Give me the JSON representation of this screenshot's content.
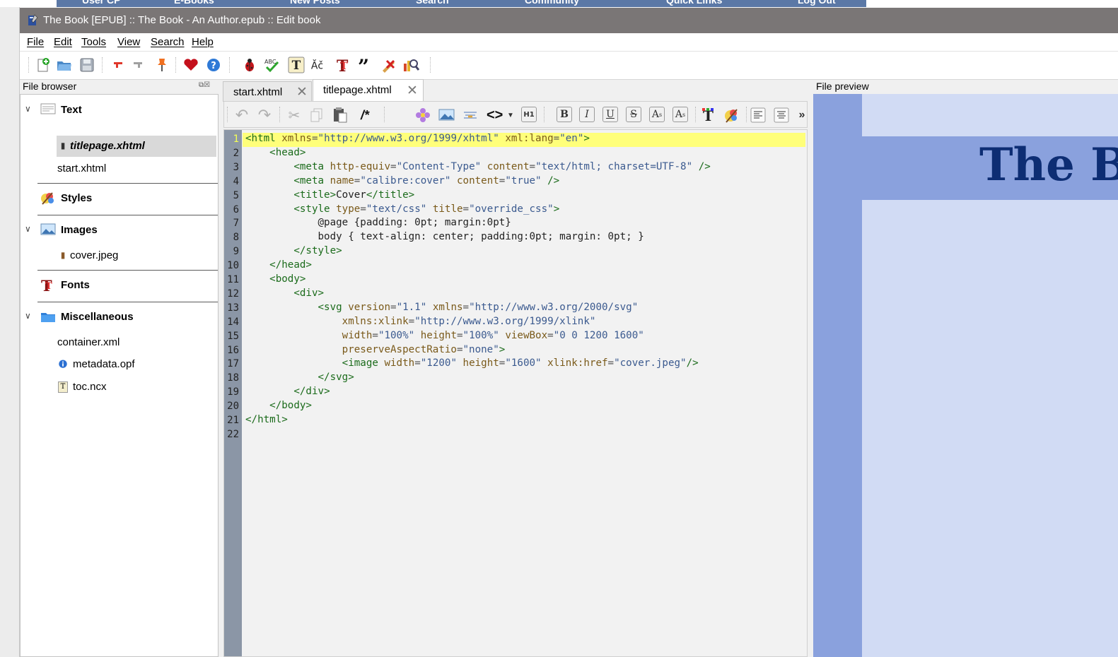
{
  "background_site": {
    "nav_items": [
      "User CP",
      "E-Books",
      "New Posts",
      "Search",
      "Community",
      "Quick Links",
      "Log Out"
    ]
  },
  "window": {
    "title": "The Book [EPUB] :: The Book - An Author.epub :: Edit book"
  },
  "menu": [
    "File",
    "Edit",
    "Tools",
    "View",
    "Search",
    "Help"
  ],
  "toolbar_icons": [
    "new-file-icon",
    "open-folder-icon",
    "save-icon",
    "previous-checkpoint-icon",
    "next-checkpoint-icon",
    "pin-icon",
    "heart-icon",
    "help-icon",
    "bug-check-icon",
    "spell-check-icon",
    "text-tool-icon",
    "accents-icon",
    "fonts-tool-icon",
    "smart-quotes-icon",
    "remove-unused-icon",
    "reports-icon"
  ],
  "file_browser": {
    "label": "File browser",
    "categories": [
      {
        "label": "Text",
        "files": [
          "titlepage.xhtml",
          "start.xhtml"
        ]
      },
      {
        "label": "Styles",
        "files": []
      },
      {
        "label": "Images",
        "files": [
          "cover.jpeg"
        ]
      },
      {
        "label": "Fonts",
        "files": []
      },
      {
        "label": "Miscellaneous",
        "files": [
          "container.xml",
          "metadata.opf",
          "toc.ncx"
        ]
      }
    ],
    "selected_file": "titlepage.xhtml"
  },
  "tabs": [
    {
      "label": "start.xhtml",
      "active": false
    },
    {
      "label": "titlepage.xhtml",
      "active": true
    }
  ],
  "editor_toolbar": {
    "comment_label": "/*",
    "heading_label": "H1",
    "bold": "B",
    "italic": "I",
    "underline": "U",
    "strike": "S",
    "superscript": "A",
    "subscript": "A",
    "more": "»"
  },
  "editor": {
    "current_line": 1,
    "line_numbers": [
      "1",
      "2",
      "3",
      "4",
      "5",
      "6",
      "7",
      "8",
      "9",
      "10",
      "11",
      "12",
      "13",
      "14",
      "15",
      "16",
      "17",
      "18",
      "19",
      "20",
      "21",
      "22"
    ],
    "lines": [
      "<html xmlns=\"http://www.w3.org/1999/xhtml\" xml:lang=\"en\">",
      "    <head>",
      "        <meta http-equiv=\"Content-Type\" content=\"text/html; charset=UTF-8\" />",
      "        <meta name=\"calibre:cover\" content=\"true\" />",
      "        <title>Cover</title>",
      "        <style type=\"text/css\" title=\"override_css\">",
      "            @page {padding: 0pt; margin:0pt}",
      "            body { text-align: center; padding:0pt; margin: 0pt; }",
      "        </style>",
      "    </head>",
      "    <body>",
      "        <div>",
      "            <svg version=\"1.1\" xmlns=\"http://www.w3.org/2000/svg\"",
      "                xmlns:xlink=\"http://www.w3.org/1999/xlink\"",
      "                width=\"100%\" height=\"100%\" viewBox=\"0 0 1200 1600\"",
      "                preserveAspectRatio=\"none\">",
      "                <image width=\"1200\" height=\"1600\" xlink:href=\"cover.jpeg\"/>",
      "            </svg>",
      "        </div>",
      "    </body>",
      "</html>",
      ""
    ]
  },
  "preview": {
    "label": "File preview",
    "page_title": "The B"
  },
  "colors": {
    "titlebar": "#7a7676",
    "gutter": "#8b96a6",
    "current_line": "#ffff7a",
    "preview_bg": "#8aa1dd",
    "preview_page": "#d1dbf4",
    "preview_title": "#0d2d73"
  }
}
